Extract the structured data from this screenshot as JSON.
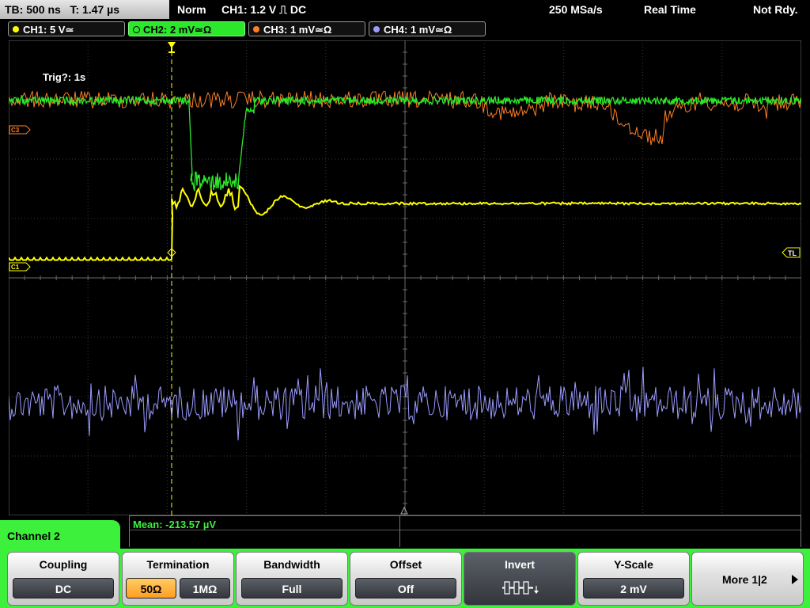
{
  "top": {
    "timebase": "TB: 500 ns",
    "trigger_time": "T: 1.47 µs",
    "mode": "Norm",
    "trigger": "CH1: 1.2 V ⎍ DC",
    "sample_rate": "250 MSa/s",
    "acq_mode": "Real Time",
    "status": "Not Rdy."
  },
  "channels": [
    {
      "label": "CH1: 5 V≃",
      "color": "#ffff00"
    },
    {
      "label": "CH2: 2 mV≃Ω",
      "color": "#2be82b"
    },
    {
      "label": "CH3: 1 mV≃Ω",
      "color": "#ff7f24"
    },
    {
      "label": "CH4: 1 mV≃Ω",
      "color": "#9b9bff"
    }
  ],
  "plot": {
    "trig_info": "Trig?: 1s",
    "marker_c3": "C3",
    "marker_c1": "C1",
    "marker_tl": "TL"
  },
  "measurement": {
    "mean": "Mean: -213.57 µV"
  },
  "menu": {
    "title": "Channel 2",
    "coupling": {
      "title": "Coupling",
      "value": "DC"
    },
    "termination": {
      "title": "Termination",
      "opt1": "50Ω",
      "opt2": "1MΩ"
    },
    "bandwidth": {
      "title": "Bandwidth",
      "value": "Full"
    },
    "offset": {
      "title": "Offset",
      "value": "Off"
    },
    "invert": {
      "title": "Invert"
    },
    "yscale": {
      "title": "Y-Scale",
      "value": "2 mV"
    },
    "more": {
      "label": "More 1|2"
    }
  }
}
